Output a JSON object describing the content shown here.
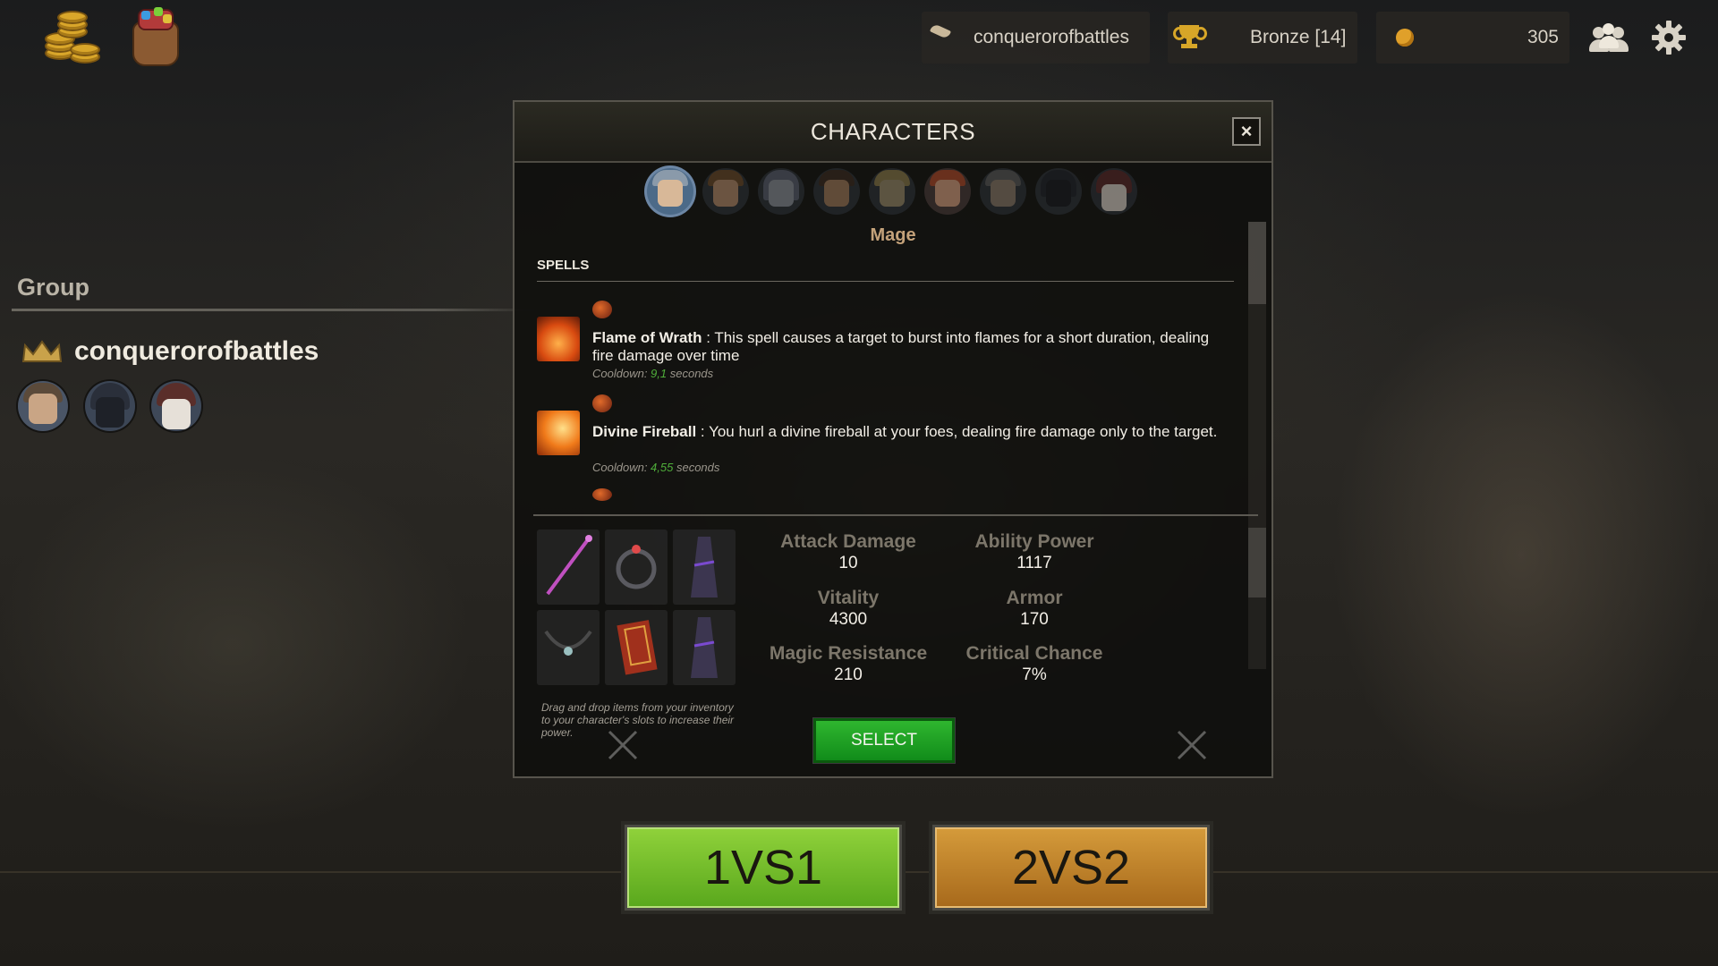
{
  "topbar": {
    "username": "conquerorofbattles",
    "rank": "Bronze [14]",
    "gold": "305"
  },
  "group": {
    "title": "Group",
    "leader": "conquerorofbattles"
  },
  "modal": {
    "title": "CHARACTERS",
    "close_label": "×",
    "selected_class": "Mage",
    "spells_title": "SPELLS",
    "spells": [
      {
        "name": "Flame of Wrath",
        "description": " : This spell causes a target to burst into flames for a short duration, dealing fire damage over time",
        "cooldown_prefix": "Cooldown: ",
        "cooldown_value": "9,1",
        "cooldown_suffix": " seconds"
      },
      {
        "name": "Divine Fireball",
        "description": " : You hurl a divine fireball at your foes, dealing fire damage only to the target.",
        "cooldown_prefix": "Cooldown: ",
        "cooldown_value": "4,55",
        "cooldown_suffix": " seconds"
      }
    ],
    "stats": [
      {
        "label": "Attack Damage",
        "value": "10"
      },
      {
        "label": "Ability Power",
        "value": "1117"
      },
      {
        "label": "Vitality",
        "value": "4300"
      },
      {
        "label": "Armor",
        "value": "170"
      },
      {
        "label": "Magic Resistance",
        "value": "210"
      },
      {
        "label": "Critical Chance",
        "value": "7%"
      }
    ],
    "hint": "Drag and drop items from your inventory to your character's slots to increase their power.",
    "select_label": "SELECT"
  },
  "modes": {
    "one_v_one": "1VS1",
    "two_v_two": "2VS2"
  },
  "colors": {
    "select_green": "#1ea326",
    "mode_1v1_green": "#7cc12e",
    "mode_2v2_orange": "#c4862f",
    "class_name": "#c4a27a"
  }
}
